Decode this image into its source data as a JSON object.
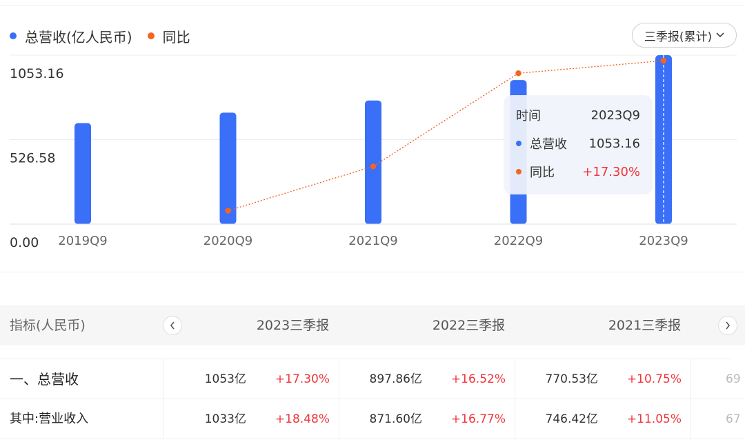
{
  "legend": {
    "revenue_label": "总营收(亿人民币)",
    "yoy_label": "同比",
    "revenue_color": "#3a6ff7",
    "yoy_color": "#f26522"
  },
  "period_select": {
    "label": "三季报(累计)",
    "icon": "chevron-down-icon"
  },
  "chart_data": {
    "type": "bar",
    "categories": [
      "2019Q9",
      "2020Q9",
      "2021Q9",
      "2022Q9",
      "2023Q9"
    ],
    "series": [
      {
        "name": "总营收(亿人民币)",
        "type": "bar",
        "values": [
          630,
          695,
          770.53,
          897.86,
          1053.16
        ],
        "color": "#3a6ff7"
      },
      {
        "name": "同比",
        "type": "line",
        "values": [
          null,
          8.0,
          10.75,
          16.52,
          17.3
        ],
        "color": "#f26522"
      }
    ],
    "y_ticks": [
      "1053.16",
      "526.58",
      "0.00"
    ],
    "ylim": [
      0,
      1053.16
    ],
    "grid": true
  },
  "tooltip": {
    "time_label": "时间",
    "time_value": "2023Q9",
    "revenue_label": "总营收",
    "revenue_value": "1053.16",
    "yoy_label": "同比",
    "yoy_value": "+17.30%"
  },
  "table": {
    "header_title": "指标(人民币)",
    "columns": [
      "2023三季报",
      "2022三季报",
      "2021三季报"
    ],
    "rows": [
      {
        "label": "一、总营收",
        "cells": [
          {
            "v": "1053亿",
            "p": "+17.30%"
          },
          {
            "v": "897.86亿",
            "p": "+16.52%"
          },
          {
            "v": "770.53亿",
            "p": "+10.75%"
          }
        ],
        "cut": "69"
      },
      {
        "label": "其中:营业收入",
        "cells": [
          {
            "v": "1033亿",
            "p": "+18.48%"
          },
          {
            "v": "871.60亿",
            "p": "+16.77%"
          },
          {
            "v": "746.42亿",
            "p": "+11.05%"
          }
        ],
        "cut": "67"
      }
    ]
  }
}
